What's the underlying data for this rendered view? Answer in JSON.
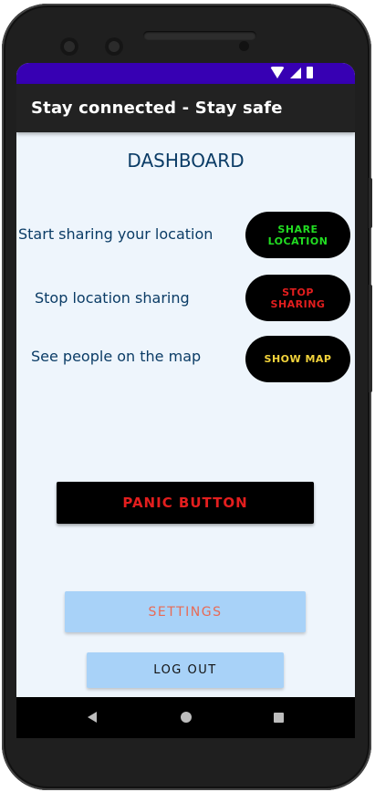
{
  "app": {
    "title": "Stay connected - Stay safe",
    "colors": {
      "status_bar": "#3700b3",
      "app_bar": "#222222",
      "background": "#eef5fc",
      "heading": "#0b3c66"
    }
  },
  "status_bar": {
    "icons": [
      "wifi-icon",
      "signal-icon",
      "battery-icon"
    ]
  },
  "dashboard": {
    "title": "DASHBOARD",
    "rows": [
      {
        "label": "Start sharing your location",
        "button": "SHARE\nLOCATION",
        "color": "#22dd22"
      },
      {
        "label": "Stop location sharing",
        "button": "STOP\nSHARING",
        "color": "#e31e1e"
      },
      {
        "label": "See people on the map",
        "button": "SHOW MAP",
        "color": "#f2d33b"
      }
    ]
  },
  "actions": {
    "panic": "PANIC BUTTON",
    "settings": "SETTINGS",
    "logout": "LOG OUT"
  },
  "nav_bar": {
    "icons": [
      "back-icon",
      "home-icon",
      "recents-icon"
    ]
  }
}
